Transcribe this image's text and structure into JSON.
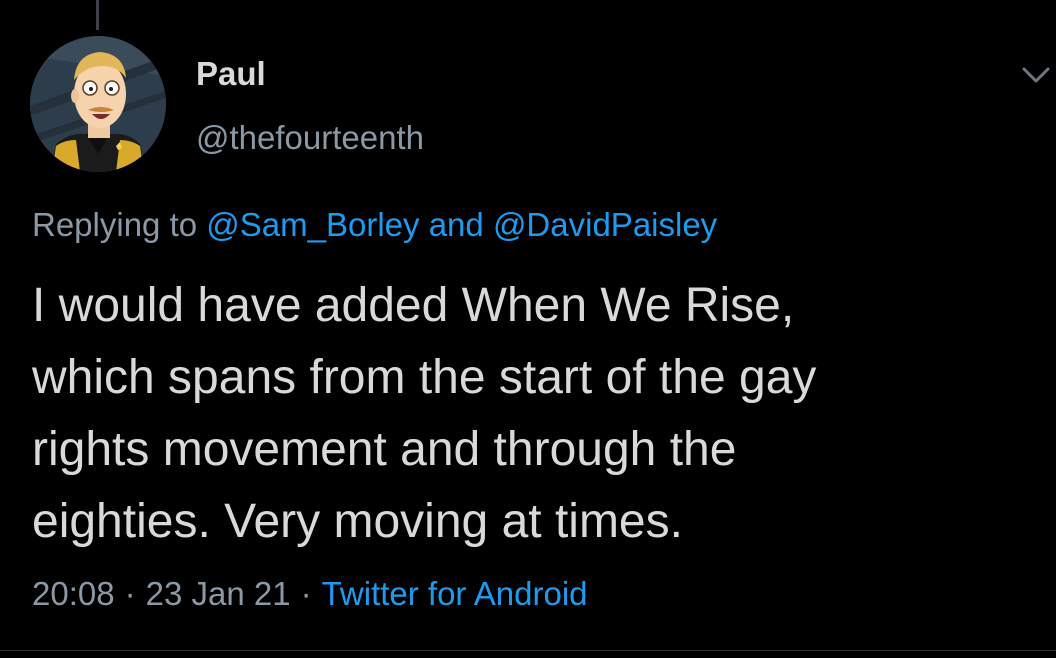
{
  "tweet": {
    "author": {
      "display_name": "Paul",
      "handle": "@thefourteenth",
      "avatar_icon": "cartoon-officer-avatar"
    },
    "replying": {
      "prefix": "Replying to",
      "mention_1": "@Sam_Borley",
      "joiner": "and",
      "mention_2": "@DavidPaisley"
    },
    "text_lines": [
      "I would have added When We Rise,",
      "which spans from the start of the gay",
      "rights movement and through the",
      "eighties. Very moving at times."
    ],
    "time": "20:08",
    "separator": "·",
    "date": "23 Jan 21",
    "source": "Twitter for Android",
    "menu_icon": "chevron-down-icon"
  },
  "colors": {
    "background": "#000000",
    "text": "#d9d9d9",
    "secondary": "#8b98a5",
    "link": "#1d9bf0"
  }
}
